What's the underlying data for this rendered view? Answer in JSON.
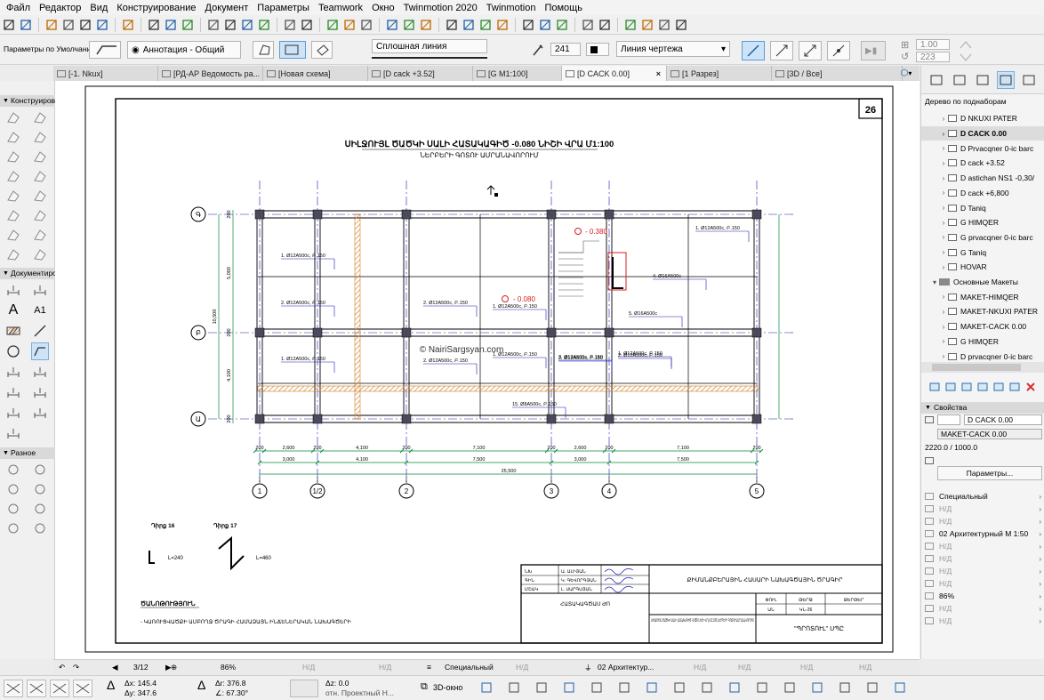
{
  "menu": [
    "Файл",
    "Редактор",
    "Вид",
    "Конструирование",
    "Документ",
    "Параметры",
    "Teamwork",
    "Окно",
    "Twinmotion 2020",
    "Twinmotion",
    "Помощь"
  ],
  "toolbar2": {
    "defaults": "Параметры по Умолчанию",
    "layer": "Аннотация - Общий",
    "line_type": "Сплошная линия",
    "pen": "241",
    "pen_type": "Линия чертежа",
    "val1": "1.00",
    "val2": "223"
  },
  "tabs": [
    {
      "label": "[-1. Nkux]",
      "active": false
    },
    {
      "label": "[РД-АР Ведомость ра...",
      "active": false
    },
    {
      "label": "[Новая схема]",
      "active": false
    },
    {
      "label": "[D cack +3.52]",
      "active": false
    },
    {
      "label": "[G M1:100]",
      "active": false
    },
    {
      "label": "[D CACK 0.00]",
      "active": true,
      "close": "×"
    },
    {
      "label": "[1 Разрез]",
      "active": false
    },
    {
      "label": "[3D / Все]",
      "active": false
    }
  ],
  "toolbox": {
    "sections": [
      "Конструиров",
      "Документиро",
      "Разное"
    ],
    "text_tool": "A",
    "label_tool": "A1"
  },
  "navigator": {
    "title": "Дерево по поднаборам",
    "items": [
      {
        "label": "D NKUXI PATER",
        "type": "layout",
        "selected": false,
        "indent": 1
      },
      {
        "label": "D CACK 0.00",
        "type": "layout",
        "selected": true,
        "indent": 1
      },
      {
        "label": "D Prvacqner 0-ic barc",
        "type": "layout",
        "selected": false,
        "indent": 1
      },
      {
        "label": "D cack +3.52",
        "type": "layout",
        "selected": false,
        "indent": 1
      },
      {
        "label": "D astichan NS1 -0,30/",
        "type": "layout",
        "selected": false,
        "indent": 1
      },
      {
        "label": "D cack +6,800",
        "type": "layout",
        "selected": false,
        "indent": 1
      },
      {
        "label": "D Taniq",
        "type": "layout",
        "selected": false,
        "indent": 1
      },
      {
        "label": "G HIMQER",
        "type": "layout",
        "selected": false,
        "indent": 1
      },
      {
        "label": "G prvacqner 0-ic barc",
        "type": "layout",
        "selected": false,
        "indent": 1
      },
      {
        "label": "G Taniq",
        "type": "layout",
        "selected": false,
        "indent": 1
      },
      {
        "label": "HOVAR",
        "type": "layout",
        "selected": false,
        "indent": 1
      },
      {
        "label": "Основные Макеты",
        "type": "folder",
        "selected": false,
        "indent": 0
      },
      {
        "label": "MAKET-HIMQER",
        "type": "master",
        "selected": false,
        "indent": 1
      },
      {
        "label": "MAKET-NKUXI PATER",
        "type": "master",
        "selected": false,
        "indent": 1
      },
      {
        "label": "MAKET-CACK 0.00",
        "type": "master",
        "selected": false,
        "indent": 1
      },
      {
        "label": "G HIMQER",
        "type": "master",
        "selected": false,
        "indent": 1
      },
      {
        "label": "D prvacqner 0-ic barc",
        "type": "master",
        "selected": false,
        "indent": 1
      }
    ]
  },
  "properties": {
    "title": "Свойства",
    "name": "D CACK 0.00",
    "master": "MAKET-CACK 0.00",
    "size": "2220.0 / 1000.0",
    "button": "Параметры...",
    "rows": [
      "Специальный",
      "Н/Д",
      "Н/Д",
      "02 Архитектурный М 1:50",
      "Н/Д",
      "Н/Д",
      "Н/Д",
      "Н/Д",
      "86%",
      "Н/Д",
      "Н/Д"
    ]
  },
  "statusbar": {
    "page": "3/12",
    "zoom": "86%",
    "nd1": "Н/Д",
    "nd2": "Н/Д",
    "layer_combo": "Специальный",
    "nd3": "Н/Д",
    "scale": "02 Архитектур...",
    "nd4": "Н/Д",
    "nd5": "Н/Д",
    "nd6": "Н/Д",
    "nd7": "Н/Д"
  },
  "coords": {
    "dx": "Δx: 145.4",
    "dy": "Δy: 347.6",
    "dr": "Δr: 376.8",
    "da": "∠: 67.30°",
    "dz": "Δz: 0.0",
    "ref": "отн. Проектный Н...",
    "view3d": "3D-окно"
  },
  "drawing": {
    "sheet_no": "26",
    "title": "ՍԻԼՋՈՒՅԼ ԾԱԾԿԻ ՍԱԼԻ ՀԱՏԱԿԱԳԻԾ -0.080 ՆԻՇԻ ՎՐԱ Մ1:100",
    "subtitle": "ՆԵՐԲԵՐԻ ԳՈՏՈՒ ԱՄՐԱՆԱՎՈՐՈՒՄ",
    "watermark": "© NairiSargsyan.com",
    "level1": "- 0.380",
    "level2": "- 0.080",
    "axes_bottom": [
      "1",
      "1/2",
      "2",
      "3",
      "4",
      "5"
    ],
    "axes_left": [
      "Գ",
      "Բ",
      "Ա"
    ],
    "dims_row1": [
      "200",
      "2,600",
      "200",
      "4,100",
      "200",
      "7,100",
      "200",
      "2,600",
      "200",
      "7,100",
      "200"
    ],
    "dims_row2": [
      "3,000",
      "4,100",
      "7,500",
      "3,000",
      "7,500"
    ],
    "dims_total": "25,500",
    "dims_left": [
      "200",
      "5,000",
      "200",
      "4,100",
      "200"
    ],
    "dims_left_total": "10,500",
    "rebar": [
      "1. Ø12A500c, Բ.150",
      "2. Ø12A500c, Բ.150",
      "1. Ø12A500c, Բ.150",
      "2. Ø12A500c, Բ.150",
      "1. Ø12A500c, Բ.150",
      "2. Ø12A500c, Բ.150",
      "1. Ø12A500c, Բ.150",
      "1. Ø12A500c, Բ.150",
      "2. Ø12A500c, Բ.150",
      "1. Ø12A500c, Բ.150",
      "2. Ø12A500c, Բ.150",
      "3. Ø12A500c, Բ.150",
      "4. Ø16A500c",
      "5. Ø16A500c",
      "15. Ø8A500c, Բ.150"
    ],
    "detail1": "Դիրք 16",
    "detail2": "Դիրք 17",
    "detail1_dim": "L=240",
    "detail2_dim": "L=460",
    "notes_title": "ԾԱՆՈԹՈՒԹՅՈՒՆ",
    "notes_text": "- ԿԱՌՈՒՑՎԱԾՔԻ ԱՄԲՈՂՋ ԾՐԱԳԻ ՀԱՄԱՁԱՅՆ ԻՆՃԵՆԵՐԱԿԱՆ ՆԱԽԱԳԾԵՐԻ",
    "stamp": {
      "org": "ՔԻՄԱՆՔԲԵՐԱՅԻՆ ՀԱՍԱՐԻ ՆԱԽԱԳԾԱՅԻՆ ԾՐԱԳԻՐ",
      "r1": [
        "ՆԽ",
        "Ա. ԱԼԻՅԱՆ"
      ],
      "r2": [
        "ԳԻՆ",
        "Կ. ԳԵՎՈՐԳՅԱՆ"
      ],
      "r3": [
        "ՄՇԱԿ",
        "Լ. ՍԱՐԳՍՅԱՆ"
      ],
      "stage": "ՀԱՏԱԿԱԳԾԱՍ ԺՈ",
      "headers": [
        "ՓՈՒԼ",
        "ԹԵՐԹ",
        "ԹԵՐԹԵՐ"
      ],
      "values": [
        "ԱՆ",
        "ԿՆ-26",
        ""
      ],
      "desc": "ՍԻԼՋՈՒՅԼ ԾԱԾԿԻ ՍԱԼԻ ՀԱՏԱԿԱԳԻԾ -0.080 ՆԻՇԻ ՎՐԱ Մ1:100 ՆԵՐԲԵՐԻ ԳՈՏՈՒ ԱՄՐԱՆԱՎՈՐՈՒՄ",
      "company": "\"ՊՐՈՏՈՒԼ\" ՍՊԸ"
    }
  }
}
